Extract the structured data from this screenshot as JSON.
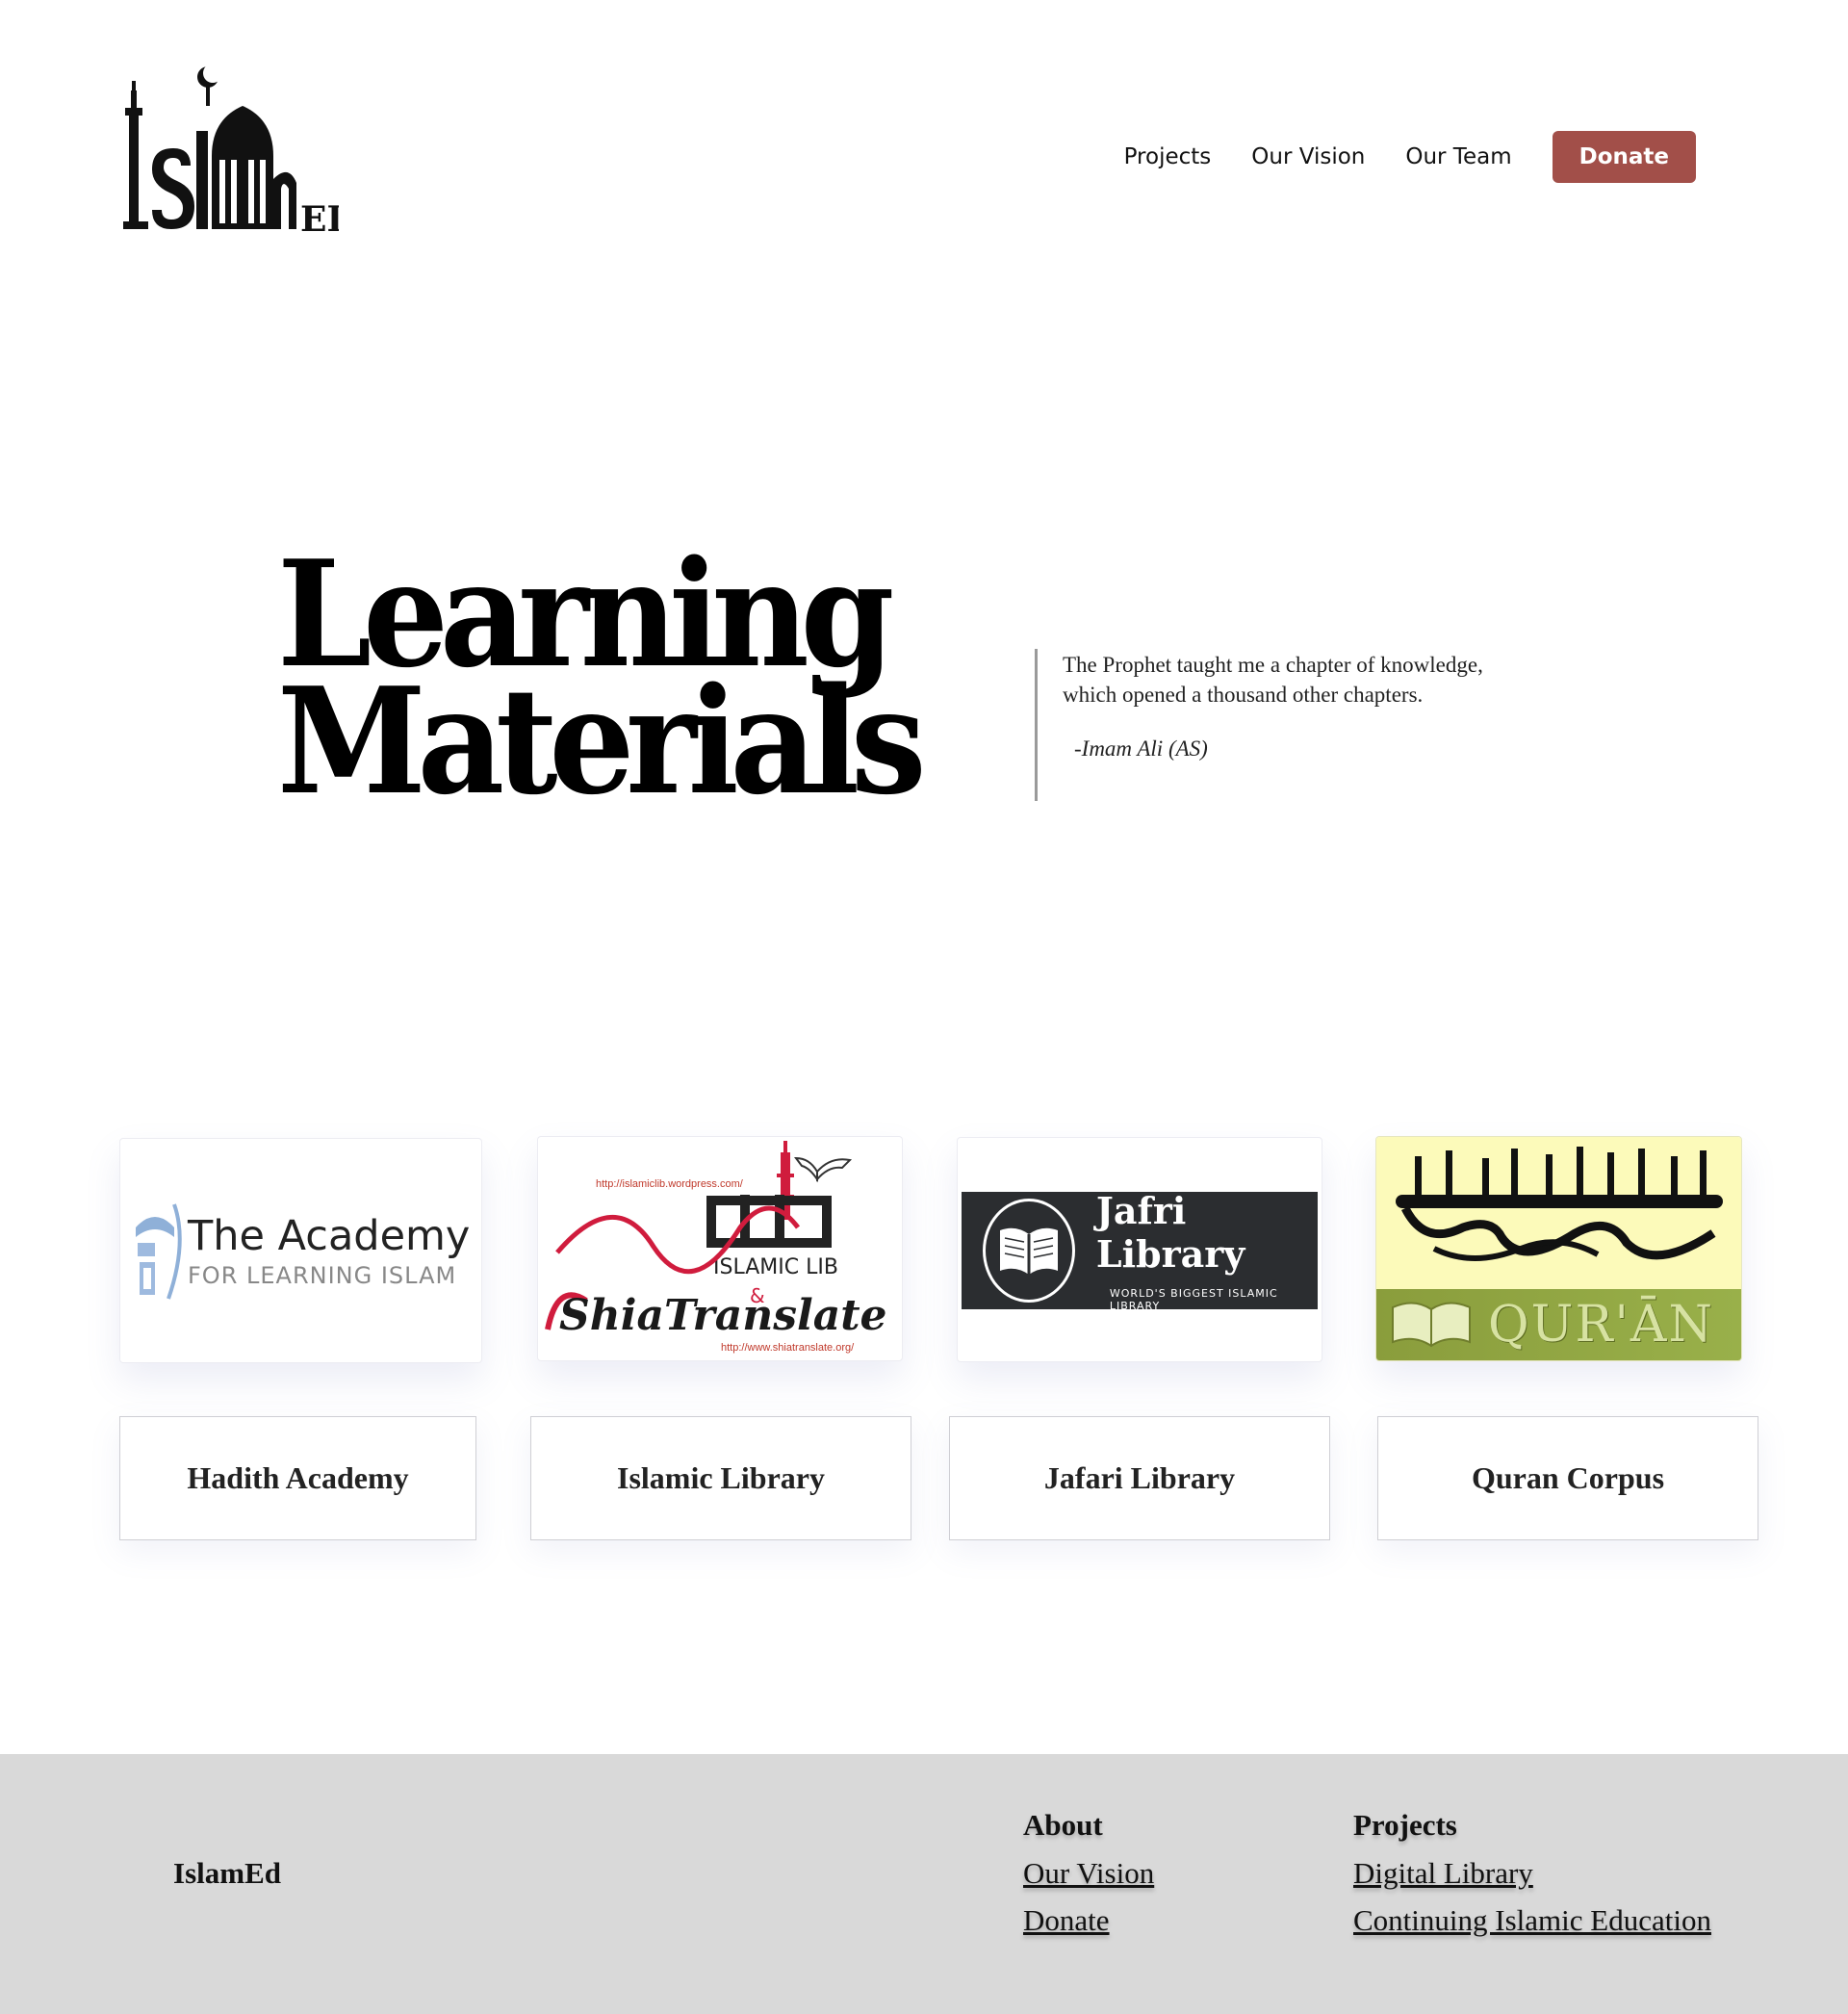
{
  "header": {
    "logo_alt": "IslamEd",
    "nav": [
      {
        "label": "Projects"
      },
      {
        "label": "Our Vision"
      },
      {
        "label": "Our Team"
      }
    ],
    "donate_label": "Donate",
    "donate_color": "#a24f49"
  },
  "hero": {
    "title_line1": "Learning",
    "title_line2": "Materials",
    "quote": "The Prophet taught me a chapter of knowledge, which opened a thousand other chapters.",
    "attribution": "-Imam Ali (AS)"
  },
  "cards": [
    {
      "label": "Hadith Academy",
      "logo_main": "The Academy",
      "logo_sub": "FOR LEARNING ISLAM"
    },
    {
      "label": "Islamic Library",
      "logo_url_top": "http://islamiclib.wordpress.com/",
      "logo_main": "ISLAMIC LIB",
      "logo_amp": "&",
      "logo_script": "ShiaTranslate",
      "logo_url_bottom": "http://www.shiatranslate.org/",
      "accent": "#d01c3d"
    },
    {
      "label": "Jafari Library",
      "logo_main": "Jafri Library",
      "logo_sub": "WORLD'S BIGGEST ISLAMIC LIBRARY",
      "band_color": "#2b2d30"
    },
    {
      "label": "Quran Corpus",
      "logo_word": "QUR'ĀN",
      "top_color": "#fcfaba",
      "bottom_color": "#93a845"
    }
  ],
  "footer": {
    "brand": "IslamEd",
    "about_heading": "About",
    "about_links": [
      "Our Vision",
      "Donate"
    ],
    "projects_heading": "Projects",
    "projects_links": [
      "Digital Library",
      "Continuing Islamic Education"
    ],
    "background": "#d9d9d9"
  }
}
